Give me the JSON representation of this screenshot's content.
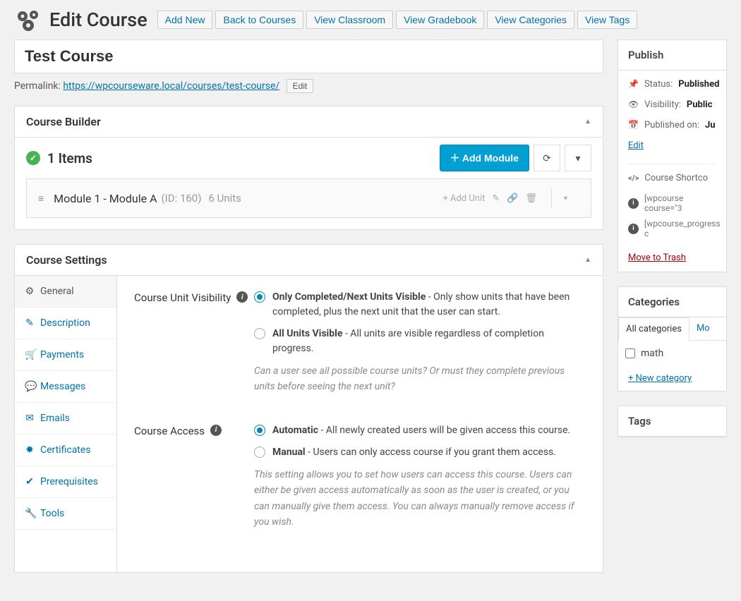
{
  "header": {
    "title": "Edit Course",
    "buttons": {
      "add_new": "Add New",
      "back": "Back to Courses",
      "classroom": "View Classroom",
      "gradebook": "View Gradebook",
      "categories": "View Categories",
      "tags": "View Tags"
    }
  },
  "course": {
    "title": "Test Course",
    "permalink_label": "Permalink:",
    "permalink_url": "https://wpcourseware.local/courses/test-course/",
    "edit_label": "Edit"
  },
  "builder": {
    "panel_title": "Course Builder",
    "items_count": "1 Items",
    "add_module": "Add Module",
    "module": {
      "name": "Module 1 - Module A",
      "id_label": "(ID: 160)",
      "units": "6 Units",
      "add_unit": "+ Add Unit"
    }
  },
  "settings": {
    "panel_title": "Course Settings",
    "nav": {
      "general": "General",
      "description": "Description",
      "payments": "Payments",
      "messages": "Messages",
      "emails": "Emails",
      "certificates": "Certificates",
      "prerequisites": "Prerequisites",
      "tools": "Tools"
    },
    "visibility": {
      "label": "Course Unit Visibility",
      "opt1_strong": "Only Completed/Next Units Visible",
      "opt1_rest": " - Only show units that have been completed, plus the next unit that the user can start.",
      "opt2_strong": "All Units Visible",
      "opt2_rest": " - All units are visible regardless of completion progress.",
      "help": "Can a user see all possible course units? Or must they complete previous units before seeing the next unit?"
    },
    "access": {
      "label": "Course Access",
      "opt1_strong": "Automatic",
      "opt1_rest": " - All newly created users will be given access this course.",
      "opt2_strong": "Manual",
      "opt2_rest": " - Users can only access course if you grant them access.",
      "help": "This setting allows you to set how users can access this course. Users can either be given access automatically as soon as the user is created, or you can manually give them access. You can always manually remove access if you wish."
    }
  },
  "publish": {
    "panel_title": "Publish",
    "status_label": "Status:",
    "status_value": "Published",
    "visibility_label": "Visibility:",
    "visibility_value": "Public",
    "published_label": "Published on:",
    "published_value": "Ju",
    "edit_link": "Edit",
    "shortcode_title": "Course Shortco",
    "shortcode1": "[wpcourse course=\"3",
    "shortcode2": "[wpcourse_progress c",
    "trash": "Move to Trash"
  },
  "categories": {
    "panel_title": "Categories",
    "tab_all": "All categories",
    "tab_most": "Mo",
    "item_math": "math",
    "new_cat": "+ New category"
  },
  "tags": {
    "panel_title": "Tags"
  }
}
